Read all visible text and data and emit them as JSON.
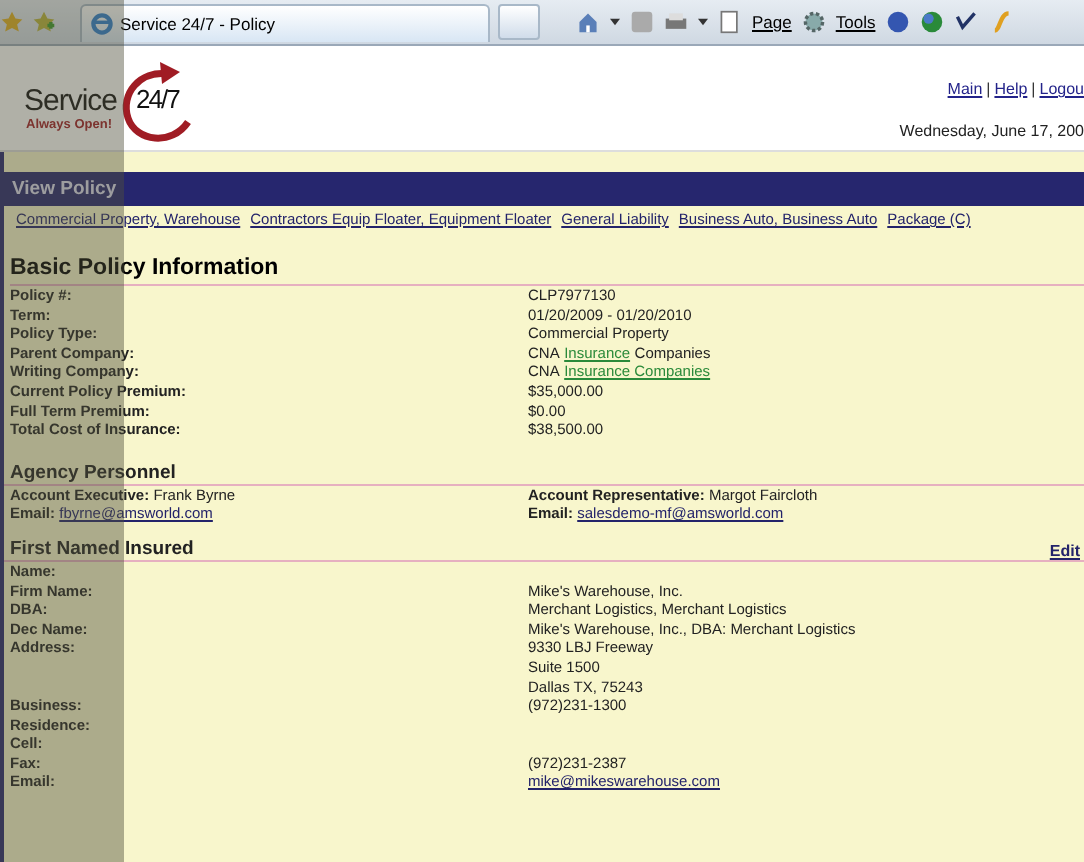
{
  "browser": {
    "tab_title": "Service 24/7 - Policy",
    "menus": [
      "Page",
      "Tools"
    ]
  },
  "header": {
    "logo": {
      "word": "Service",
      "number": "24/7",
      "tagline": "Always Open!"
    },
    "nav": [
      {
        "text": "Main",
        "kind": "link"
      },
      {
        "text": "|",
        "kind": "separator"
      },
      {
        "text": "Help",
        "kind": "link"
      },
      {
        "text": "|",
        "kind": "separator"
      },
      {
        "text": "Logou",
        "kind": "link"
      }
    ],
    "date": "Wednesday, June 17, 200"
  },
  "title_bar": "View Policy",
  "policy_tabs": [
    "Commercial Property, Warehouse",
    "Contractors Equip Floater, Equipment Floater",
    "General Liability",
    "Business Auto, Business Auto",
    "Package (C)"
  ],
  "basic": {
    "heading": "Basic Policy Information",
    "rows": [
      {
        "label": "Policy #:",
        "value": [
          {
            "text": "CLP7977130",
            "kind": "plain"
          }
        ]
      },
      {
        "label": "Term:",
        "value": [
          {
            "text": "01/20/2009 - 01/20/2010",
            "kind": "plain"
          }
        ]
      },
      {
        "label": "Policy Type:",
        "value": [
          {
            "text": "Commercial Property",
            "kind": "plain"
          }
        ]
      },
      {
        "label": "Parent Company:",
        "value": [
          {
            "text": "CNA",
            "kind": "plain"
          },
          {
            "text": "Insurance",
            "kind": "link"
          },
          {
            "text": "Companies",
            "kind": "plain"
          }
        ]
      },
      {
        "label": "Writing Company:",
        "value": [
          {
            "text": "CNA",
            "kind": "plain"
          },
          {
            "text": "Insurance Companies",
            "kind": "link"
          }
        ]
      },
      {
        "label": "Current Policy Premium:",
        "value": [
          {
            "text": "$35,000.00",
            "kind": "plain"
          }
        ]
      },
      {
        "label": "Full Term Premium:",
        "value": [
          {
            "text": "$0.00",
            "kind": "plain"
          }
        ]
      },
      {
        "label": "Total Cost of Insurance:",
        "value": [
          {
            "text": "$38,500.00",
            "kind": "plain"
          }
        ]
      }
    ]
  },
  "agency": {
    "heading": "Agency Personnel",
    "people": [
      {
        "role_label": "Account Executive:",
        "name": "Frank Byrne",
        "email_label": "Email:",
        "email": "fbyrne@amsworld.com"
      },
      {
        "role_label": "Account Representative:",
        "name": "Margot Faircloth",
        "email_label": "Email:",
        "email": "salesdemo-mf@amsworld.com"
      }
    ]
  },
  "insured": {
    "heading": "First Named Insured",
    "edit_link": "Edit",
    "rows": [
      {
        "label": "Name:",
        "value": []
      },
      {
        "label": "Firm Name:",
        "value": [
          {
            "text": "Mike's Warehouse, Inc.",
            "kind": "plain"
          }
        ]
      },
      {
        "label": "DBA:",
        "value": [
          {
            "text": "Merchant Logistics, Merchant Logistics",
            "kind": "plain"
          }
        ]
      },
      {
        "label": "Dec Name:",
        "value": [
          {
            "text": "Mike's Warehouse, Inc., DBA: Merchant Logistics",
            "kind": "plain"
          }
        ]
      },
      {
        "label": "Address:",
        "value": [
          {
            "text": "9330 LBJ Freeway",
            "kind": "plain"
          },
          {
            "text": "Suite 1500",
            "kind": "line"
          },
          {
            "text": "Dallas TX, 75243",
            "kind": "line"
          }
        ]
      },
      {
        "label": "Business:",
        "value": [
          {
            "text": "(972)231-1300",
            "kind": "plain"
          }
        ]
      },
      {
        "label": "Residence:",
        "value": []
      },
      {
        "label": "Cell:",
        "value": []
      },
      {
        "label": "Fax:",
        "value": [
          {
            "text": "(972)231-2387",
            "kind": "plain"
          }
        ]
      },
      {
        "label": "Email:",
        "value": [
          {
            "text": "mike@mikeswarehouse.com",
            "kind": "email"
          }
        ]
      }
    ]
  }
}
